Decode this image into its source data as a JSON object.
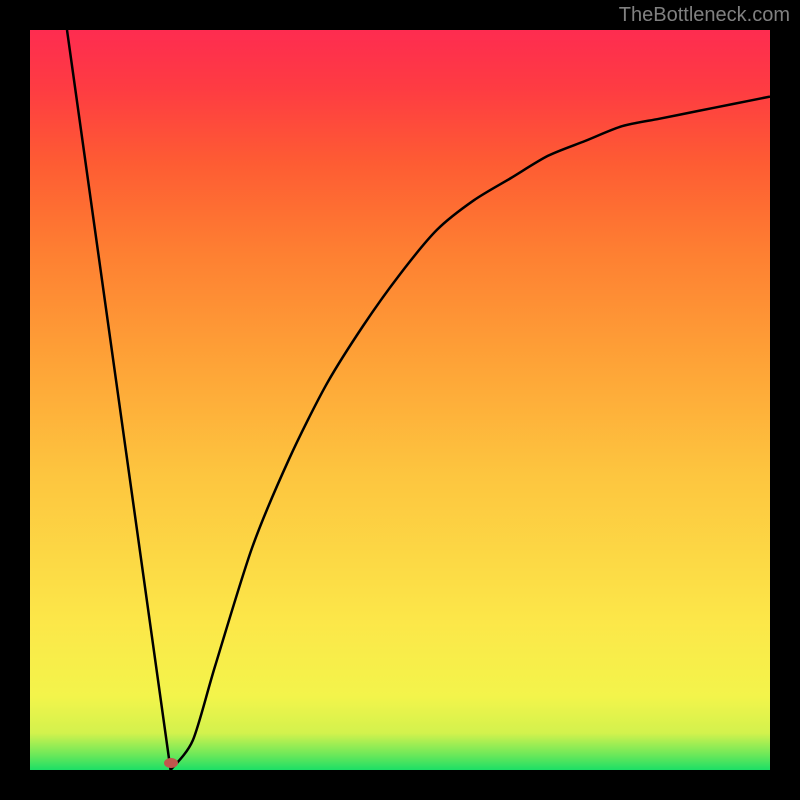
{
  "watermark": "TheBottleneck.com",
  "chart_data": {
    "type": "line",
    "title": "",
    "xlabel": "",
    "ylabel": "",
    "xlim": [
      0,
      100
    ],
    "ylim": [
      0,
      100
    ],
    "series": [
      {
        "name": "bottleneck-curve",
        "points": [
          {
            "x": 5,
            "y": 100
          },
          {
            "x": 19,
            "y": 0
          },
          {
            "x": 22,
            "y": 4
          },
          {
            "x": 25,
            "y": 14
          },
          {
            "x": 30,
            "y": 30
          },
          {
            "x": 35,
            "y": 42
          },
          {
            "x": 40,
            "y": 52
          },
          {
            "x": 45,
            "y": 60
          },
          {
            "x": 50,
            "y": 67
          },
          {
            "x": 55,
            "y": 73
          },
          {
            "x": 60,
            "y": 77
          },
          {
            "x": 65,
            "y": 80
          },
          {
            "x": 70,
            "y": 83
          },
          {
            "x": 75,
            "y": 85
          },
          {
            "x": 80,
            "y": 87
          },
          {
            "x": 85,
            "y": 88
          },
          {
            "x": 90,
            "y": 89
          },
          {
            "x": 95,
            "y": 90
          },
          {
            "x": 100,
            "y": 91
          }
        ]
      }
    ],
    "marker": {
      "x": 19,
      "y": 1
    }
  }
}
